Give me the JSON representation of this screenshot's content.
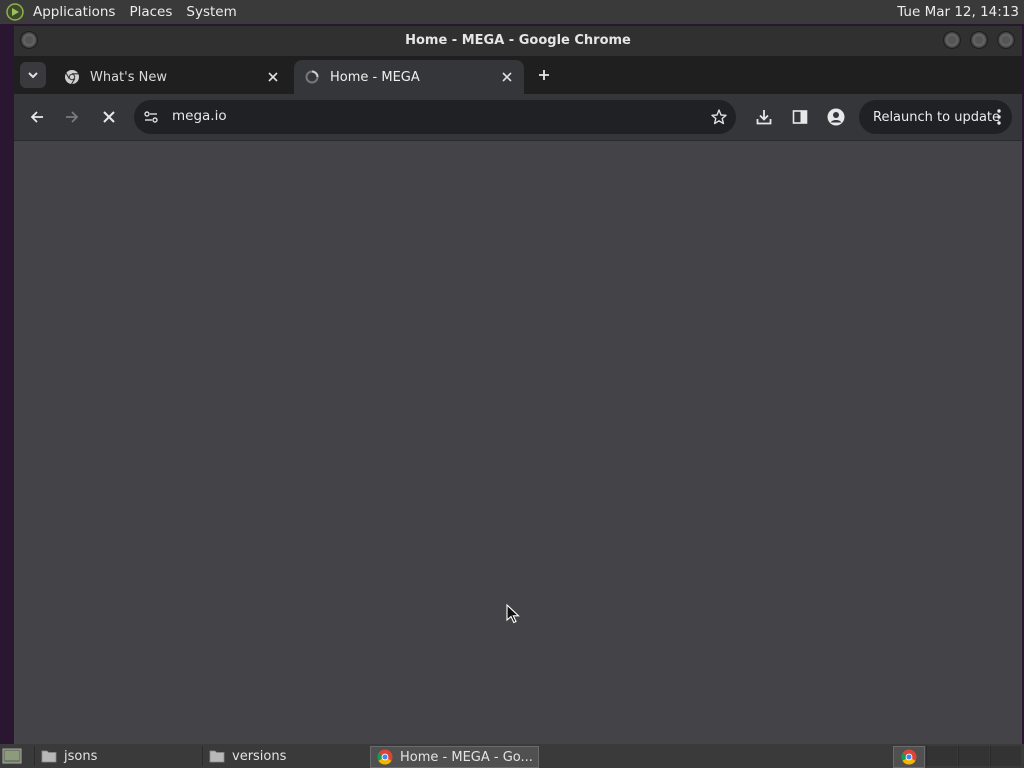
{
  "top_panel": {
    "menus": [
      "Applications",
      "Places",
      "System"
    ],
    "clock": "Tue Mar 12, 14:13"
  },
  "window": {
    "title": "Home - MEGA - Google Chrome"
  },
  "tabs": [
    {
      "label": "What's New",
      "active": false,
      "icon": "chrome-icon"
    },
    {
      "label": "Home - MEGA",
      "active": true,
      "icon": "loading-icon"
    }
  ],
  "toolbar": {
    "url": "mega.io",
    "relaunch_label": "Relaunch to update"
  },
  "taskbar": {
    "items": [
      {
        "label": "jsons",
        "icon": "folder-icon"
      },
      {
        "label": "versions",
        "icon": "folder-icon"
      },
      {
        "label": "Home - MEGA - Go...",
        "icon": "chrome-icon"
      }
    ]
  },
  "colors": {
    "panel": "#3a3a3a",
    "tab_strip": "#1f1f1f",
    "toolbar": "#35363a",
    "omnibox": "#202124",
    "content": "#444448",
    "desktop": "#2a1630"
  }
}
